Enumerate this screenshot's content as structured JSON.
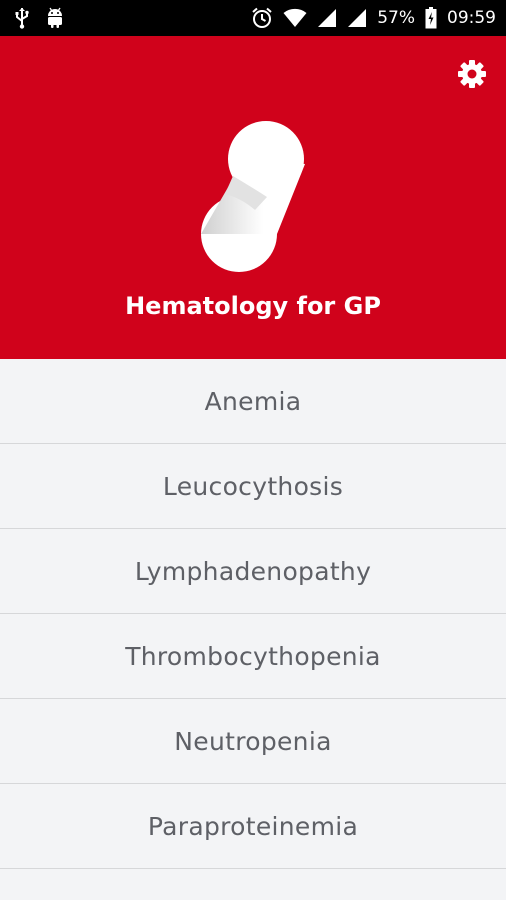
{
  "status_bar": {
    "left_icons": [
      "usb-icon",
      "android-icon"
    ],
    "right_icons": [
      "alarm-icon",
      "wifi-icon",
      "signal-icon",
      "signal-icon-2",
      "battery-icon"
    ],
    "battery": "57%",
    "time": "09:59"
  },
  "header": {
    "background_color": "#d0021b",
    "settings_icon": "gear-icon",
    "logo_icon": "pill-logo-icon",
    "title": "Hematology for GP"
  },
  "menu": {
    "items": [
      {
        "label": "Anemia"
      },
      {
        "label": "Leucocythosis"
      },
      {
        "label": "Lymphadenopathy"
      },
      {
        "label": "Thrombocythopenia"
      },
      {
        "label": "Neutropenia"
      },
      {
        "label": "Paraproteinemia"
      }
    ]
  }
}
